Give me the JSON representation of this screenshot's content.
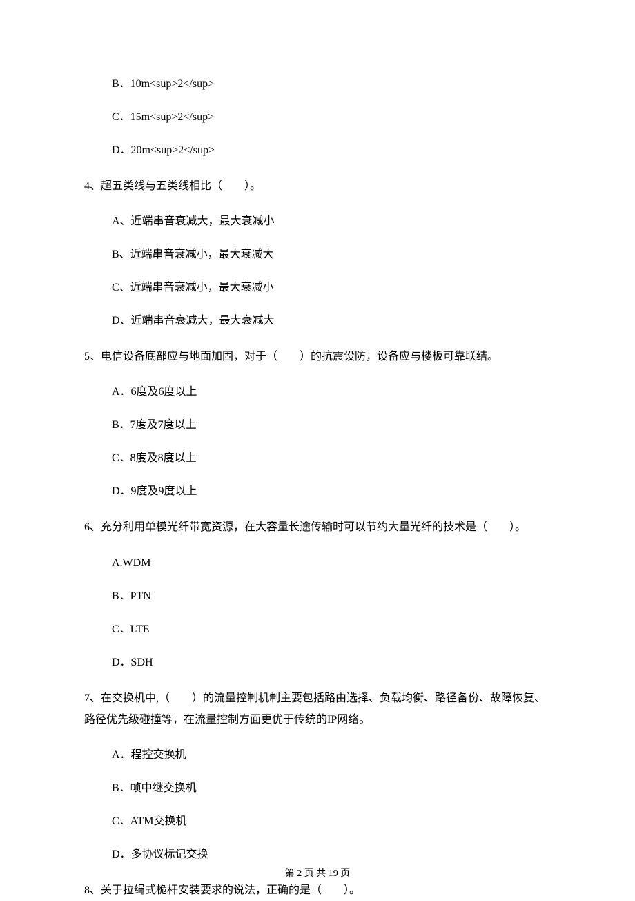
{
  "options_top": [
    "B．10m<sup>2</sup>",
    "C．15m<sup>2</sup>",
    "D．20m<sup>2</sup>"
  ],
  "q4": {
    "text": "4、超五类线与五类线相比（　　）。",
    "options": [
      "A、近端串音衰减大，最大衰减小",
      "B、近端串音衰减小，最大衰减大",
      "C、近端串音衰减小，最大衰减小",
      "D、近端串音衰减大，最大衰减大"
    ]
  },
  "q5": {
    "text": "5、电信设备底部应与地面加固，对于（　　）的抗震设防，设备应与楼板可靠联结。",
    "options": [
      "A．6度及6度以上",
      "B．7度及7度以上",
      "C．8度及8度以上",
      "D．9度及9度以上"
    ]
  },
  "q6": {
    "text": "6、充分利用单模光纤带宽资源，在大容量长途传输时可以节约大量光纤的技术是（　　）。",
    "options": [
      "A.WDM",
      "B．PTN",
      "C．LTE",
      "D．SDH"
    ]
  },
  "q7": {
    "text": "7、在交换机中,（　　）的流量控制机制主要包括路由选择、负载均衡、路径备份、故障恢复、路径优先级碰撞等，在流量控制方面更优于传统的IP网络。",
    "options": [
      "A．程控交换机",
      "B．帧中继交换机",
      "C．ATM交换机",
      "D．多协议标记交换"
    ]
  },
  "q8": {
    "text": "8、关于拉绳式桅杆安装要求的说法，正确的是（　　）。"
  },
  "footer": "第 2 页 共 19 页"
}
